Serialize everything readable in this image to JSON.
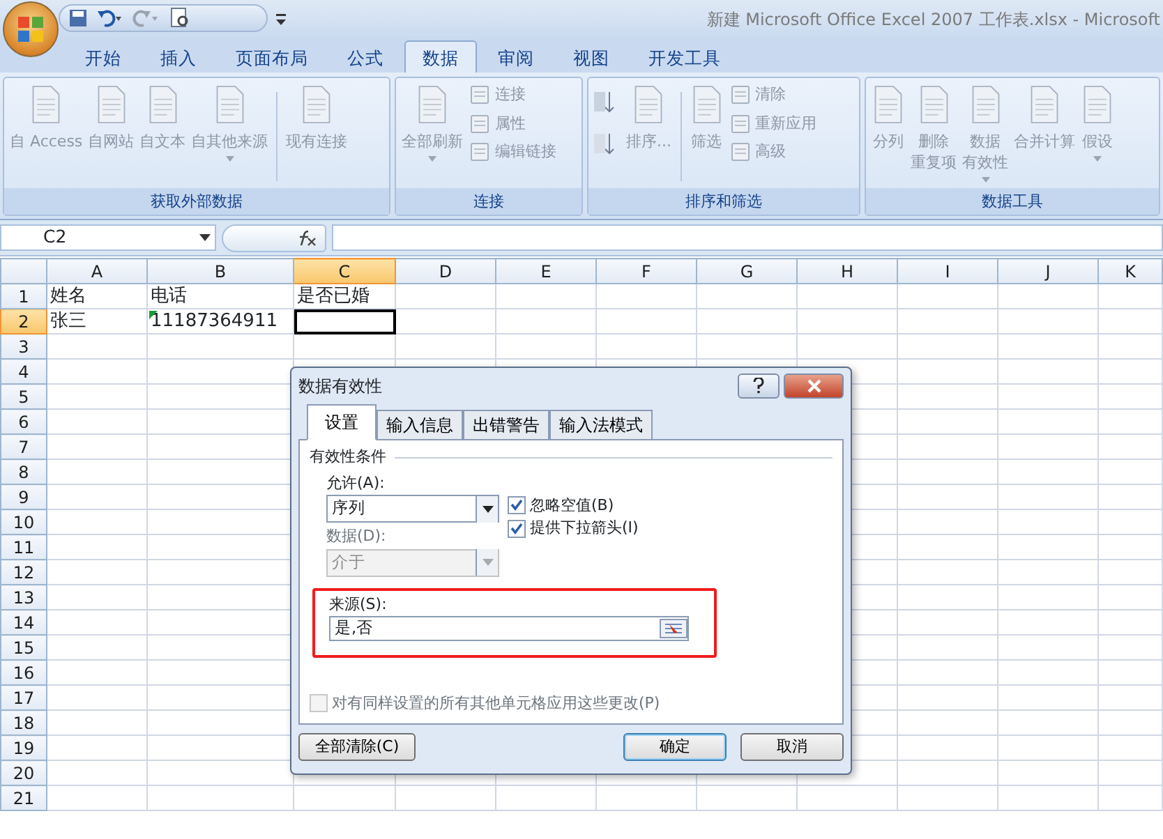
{
  "window": {
    "title": "新建 Microsoft Office Excel 2007 工作表.xlsx - Microsoft"
  },
  "ribbon_tabs": [
    {
      "label": "开始",
      "selected": false
    },
    {
      "label": "插入",
      "selected": false
    },
    {
      "label": "页面布局",
      "selected": false
    },
    {
      "label": "公式",
      "selected": false
    },
    {
      "label": "数据",
      "selected": true
    },
    {
      "label": "审阅",
      "selected": false
    },
    {
      "label": "视图",
      "selected": false
    },
    {
      "label": "开发工具",
      "selected": false
    }
  ],
  "ribbon": {
    "disabled": true,
    "groups": [
      {
        "label": "获取外部数据",
        "buttons": [
          {
            "kind": "large",
            "label": "自 Access"
          },
          {
            "kind": "large",
            "label": "自网站"
          },
          {
            "kind": "large",
            "label": "自文本"
          },
          {
            "kind": "large",
            "label": "自其他来源",
            "menu": true
          },
          {
            "kind": "separator"
          },
          {
            "kind": "large",
            "label": "现有连接"
          }
        ]
      },
      {
        "label": "连接",
        "buttons": [
          {
            "kind": "large",
            "label": "全部刷新",
            "menu": true
          },
          {
            "kind": "stack",
            "items": [
              {
                "label": "连接"
              },
              {
                "label": "属性"
              },
              {
                "label": "编辑链接"
              }
            ]
          }
        ]
      },
      {
        "label": "排序和筛选",
        "buttons": [
          {
            "kind": "sorticons"
          },
          {
            "kind": "large",
            "label": "排序..."
          },
          {
            "kind": "separator"
          },
          {
            "kind": "large",
            "label": "筛选"
          },
          {
            "kind": "stack",
            "items": [
              {
                "label": "清除"
              },
              {
                "label": "重新应用"
              },
              {
                "label": "高级"
              }
            ]
          }
        ]
      },
      {
        "label": "数据工具",
        "buttons": [
          {
            "kind": "large",
            "label": "分列"
          },
          {
            "kind": "large",
            "lines": [
              "删除",
              "重复项"
            ]
          },
          {
            "kind": "large",
            "lines": [
              "数据",
              "有效性"
            ],
            "menu": true
          },
          {
            "kind": "large",
            "label": "合并计算"
          },
          {
            "kind": "large",
            "label": "假设",
            "menu": true
          }
        ]
      }
    ]
  },
  "formula_bar": {
    "name_box": "C2"
  },
  "sheet": {
    "columns": [
      {
        "label": "A",
        "selected": false
      },
      {
        "label": "B",
        "selected": false
      },
      {
        "label": "C",
        "selected": true
      },
      {
        "label": "D",
        "selected": false
      },
      {
        "label": "E",
        "selected": false
      },
      {
        "label": "F",
        "selected": false
      },
      {
        "label": "G",
        "selected": false
      },
      {
        "label": "H",
        "selected": false
      },
      {
        "label": "I",
        "selected": false
      },
      {
        "label": "J",
        "selected": false
      },
      {
        "label": "K",
        "selected": false
      }
    ],
    "rows": [
      {
        "number": "1",
        "selected": false,
        "cells": [
          {
            "text": "姓名"
          },
          {
            "text": "电话"
          },
          {
            "text": "是否已婚"
          }
        ]
      },
      {
        "number": "2",
        "selected": true,
        "cells": [
          {
            "text": "张三"
          },
          {
            "text": "11187364911",
            "error_flag": true
          },
          {
            "active": true
          }
        ]
      },
      {
        "number": "3",
        "selected": false
      },
      {
        "number": "4",
        "selected": false
      },
      {
        "number": "5",
        "selected": false
      },
      {
        "number": "6",
        "selected": false
      },
      {
        "number": "7",
        "selected": false
      },
      {
        "number": "8",
        "selected": false
      },
      {
        "number": "9",
        "selected": false
      },
      {
        "number": "10",
        "selected": false
      },
      {
        "number": "11",
        "selected": false
      },
      {
        "number": "12",
        "selected": false
      },
      {
        "number": "13",
        "selected": false
      },
      {
        "number": "14",
        "selected": false
      },
      {
        "number": "15",
        "selected": false
      },
      {
        "number": "16",
        "selected": false
      },
      {
        "number": "17",
        "selected": false
      },
      {
        "number": "18",
        "selected": false
      },
      {
        "number": "19",
        "selected": false
      },
      {
        "number": "20",
        "selected": false
      },
      {
        "number": "21",
        "selected": false
      }
    ]
  },
  "dialog": {
    "title": "数据有效性",
    "tabs": [
      {
        "label": "设置",
        "selected": true
      },
      {
        "label": "输入信息",
        "selected": false
      },
      {
        "label": "出错警告",
        "selected": false
      },
      {
        "label": "输入法模式",
        "selected": false
      }
    ],
    "section": "有效性条件",
    "allow": {
      "label": "允许(A):",
      "value": "序列",
      "disabled": false
    },
    "data": {
      "label": "数据(D):",
      "value": "介于",
      "disabled": true
    },
    "checkboxes": [
      {
        "label": "忽略空值(B)",
        "checked": true
      },
      {
        "label": "提供下拉箭头(I)",
        "checked": true
      }
    ],
    "source": {
      "label": "来源(S):",
      "value": "是,否",
      "highlighted": true
    },
    "apply_all": {
      "label": "对有同样设置的所有其他单元格应用这些更改(P)",
      "checked": false,
      "disabled": true
    },
    "buttons": [
      {
        "label": "全部清除(C)",
        "default": false
      },
      {
        "label": "确定",
        "default": true
      },
      {
        "label": "取消",
        "default": false
      }
    ]
  }
}
